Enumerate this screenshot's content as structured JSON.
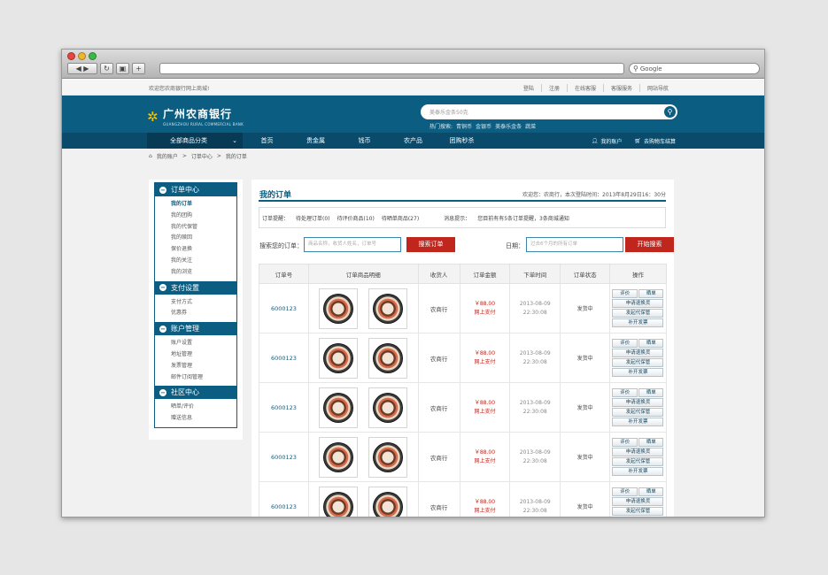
{
  "browser": {
    "search_placeholder": "Google"
  },
  "topbar": {
    "welcome": "欢迎您农商银行网上商城!",
    "links": [
      "登陆",
      "注册",
      "在线客服",
      "客服服务",
      "网站导航"
    ]
  },
  "header": {
    "logo_cn": "广州农商银行",
    "logo_en": "GUANGZHOU RURAL COMMERCIAL BANK",
    "search_placeholder": "美泰乐金条50克",
    "hot_label": "热门搜索:",
    "hot_items": [
      "青铜币",
      "金银币",
      "美泰乐金条",
      "蔬菜"
    ]
  },
  "nav": {
    "all_categories": "全部商品分类",
    "items": [
      "首页",
      "贵金属",
      "钱币",
      "农产品",
      "团购秒杀"
    ],
    "account": "我的账户",
    "cart": "去购物车结算"
  },
  "breadcrumb": [
    "我的账户",
    "订单中心",
    "我的订单"
  ],
  "sidebar": [
    {
      "title": "订单中心",
      "items": [
        "我的订单",
        "我的团购",
        "我的代保管",
        "我的赎回",
        "保价退换",
        "我的关注",
        "我的浏览"
      ]
    },
    {
      "title": "支付设置",
      "items": [
        "支付方式",
        "优惠券"
      ]
    },
    {
      "title": "账户管理",
      "items": [
        "账户设置",
        "地址管理",
        "发票管理",
        "邮件订阅管理"
      ]
    },
    {
      "title": "社区中心",
      "items": [
        "晒单/评价",
        "赠送信息"
      ]
    }
  ],
  "panel": {
    "title": "我的订单",
    "info": "欢迎您：农商行，本次登陆时间：2013年8月29日16：30分",
    "tips": {
      "label": "订单提醒：",
      "pending": "待处理订单(0)",
      "to_review": "待评价商品(10)",
      "to_share": "待晒单商品(27)",
      "msg_label": "消息提示：",
      "msg": "您目前有有5条订单提醒，3条商城通知"
    },
    "search": {
      "label": "搜索您的订单：",
      "placeholder": "商品名称，收货人姓名，订单号",
      "button": "搜索订单",
      "date_label": "日期：",
      "date_placeholder": "过去6个月的所有订单",
      "date_button": "开始搜索"
    }
  },
  "table": {
    "headers": [
      "订单号",
      "订单商品明细",
      "收货人",
      "订单金额",
      "下单时间",
      "订单状态",
      "操作"
    ],
    "ops": [
      "评价",
      "晒单",
      "申请退换货",
      "发起代保管",
      "补开发票"
    ],
    "rows": [
      {
        "order_no": "6000123",
        "receiver": "农商行",
        "amount": "￥88.00",
        "pay": "网上支付",
        "date": "2013-08-09",
        "time": "22:30:08",
        "status": "发货中"
      },
      {
        "order_no": "6000123",
        "receiver": "农商行",
        "amount": "￥88.00",
        "pay": "网上支付",
        "date": "2013-08-09",
        "time": "22:30:08",
        "status": "发货中"
      },
      {
        "order_no": "6000123",
        "receiver": "农商行",
        "amount": "￥88.00",
        "pay": "网上支付",
        "date": "2013-08-09",
        "time": "22:30:08",
        "status": "发货中"
      },
      {
        "order_no": "6000123",
        "receiver": "农商行",
        "amount": "￥88.00",
        "pay": "网上支付",
        "date": "2013-08-09",
        "time": "22:30:08",
        "status": "发货中"
      },
      {
        "order_no": "6000123",
        "receiver": "农商行",
        "amount": "￥88.00",
        "pay": "网上支付",
        "date": "2013-08-09",
        "time": "22:30:08",
        "status": "发货中"
      }
    ]
  }
}
